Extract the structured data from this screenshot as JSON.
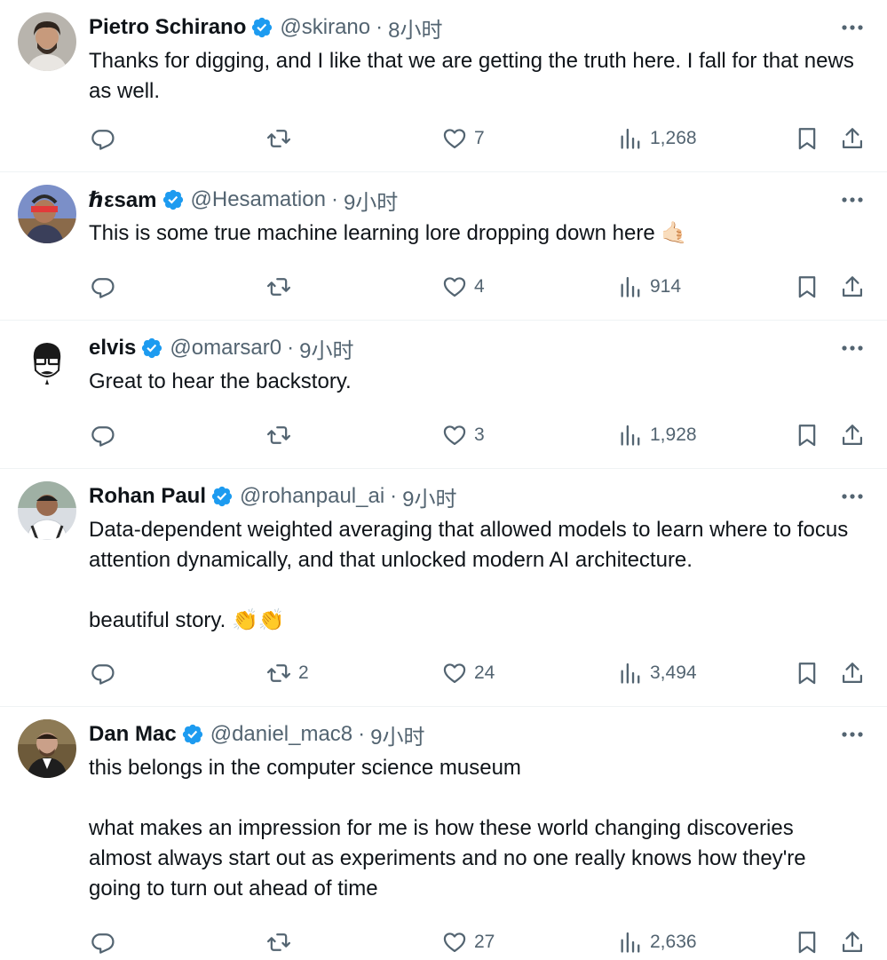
{
  "tweets": [
    {
      "name": "Pietro Schirano",
      "handle": "@skirano",
      "dot": "·",
      "time": "8小时",
      "text": [
        "Thanks for digging, and I like that we are getting the truth here. I fall for that news as well."
      ],
      "replies": "",
      "retweets": "",
      "likes": "7",
      "views": "1,268"
    },
    {
      "name": "ℏεsam",
      "handle": "@Hesamation",
      "dot": "·",
      "time": "9小时",
      "text": [
        "This is some true machine learning lore dropping down here 🤙🏻"
      ],
      "replies": "",
      "retweets": "",
      "likes": "4",
      "views": "914"
    },
    {
      "name": "elvis",
      "handle": "@omarsar0",
      "dot": "·",
      "time": "9小时",
      "text": [
        "Great to hear the backstory."
      ],
      "replies": "",
      "retweets": "",
      "likes": "3",
      "views": "1,928"
    },
    {
      "name": "Rohan Paul",
      "handle": "@rohanpaul_ai",
      "dot": "·",
      "time": "9小时",
      "text": [
        "Data-dependent weighted averaging that allowed models to learn where to focus attention dynamically, and that unlocked modern AI architecture.",
        "beautiful story. 👏👏"
      ],
      "replies": "",
      "retweets": "2",
      "likes": "24",
      "views": "3,494"
    },
    {
      "name": "Dan Mac",
      "handle": "@daniel_mac8",
      "dot": "·",
      "time": "9小时",
      "text": [
        "this belongs in the computer science museum",
        "what makes an impression for me is how these world changing discoveries almost always start out as experiments and no one really knows how they're going to turn out ahead of time"
      ],
      "replies": "",
      "retweets": "",
      "likes": "27",
      "views": "2,636"
    }
  ],
  "icons": {
    "verified": "verified-badge-icon",
    "more": "more-icon",
    "reply": "reply-icon",
    "retweet": "retweet-icon",
    "like": "like-icon",
    "views": "views-icon",
    "bookmark": "bookmark-icon",
    "share": "share-icon"
  },
  "colors": {
    "verified": "#1d9bf0",
    "text": "#0f1419",
    "muted": "#536471",
    "divider": "#eff3f4"
  }
}
